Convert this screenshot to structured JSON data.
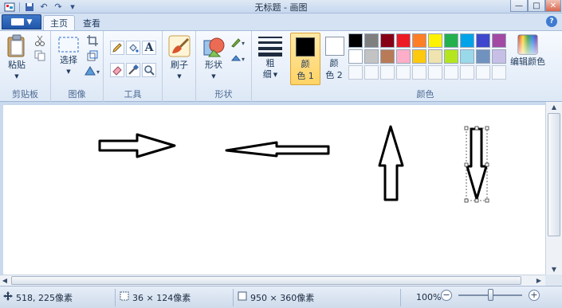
{
  "window": {
    "title": "无标题 - 画图",
    "minimize": "—",
    "maximize": "□",
    "close": "✕"
  },
  "ribbon": {
    "tabs": [
      {
        "label": "主页",
        "active": true
      },
      {
        "label": "查看",
        "active": false
      }
    ],
    "groups": {
      "clipboard": {
        "label": "剪贴板",
        "paste": "粘贴"
      },
      "image": {
        "label": "图像",
        "select": "选择"
      },
      "tools": {
        "label": "工具"
      },
      "brushes": {
        "label": "刷子"
      },
      "shapes": {
        "label": "形状",
        "shapes_button": "形状"
      },
      "size": {
        "label_line1": "粗",
        "label_line2": "细"
      },
      "colors": {
        "label": "颜色",
        "color1_line1": "颜",
        "color1_line2": "色 1",
        "color2_line1": "颜",
        "color2_line2": "色 2",
        "edit_colors": "编辑颜色",
        "color1_value": "#000000",
        "color2_value": "#ffffff"
      }
    }
  },
  "palette": {
    "row1": [
      "#000000",
      "#7f7f7f",
      "#880015",
      "#ed1c24",
      "#ff7f27",
      "#fff200",
      "#22b14c",
      "#00a2e8",
      "#3f48cc",
      "#a349a4"
    ],
    "row2": [
      "#ffffff",
      "#c3c3c3",
      "#b97a57",
      "#ffaec9",
      "#ffc90e",
      "#efe4b0",
      "#b5e61d",
      "#99d9ea",
      "#7092be",
      "#c8bfe7"
    ],
    "row3_empty": 10
  },
  "statusbar": {
    "cursor_pos": "518, 225像素",
    "selection_size": "36 × 124像素",
    "image_size": "950 × 360像素",
    "zoom": "100%"
  },
  "accent": "#1f56a8"
}
